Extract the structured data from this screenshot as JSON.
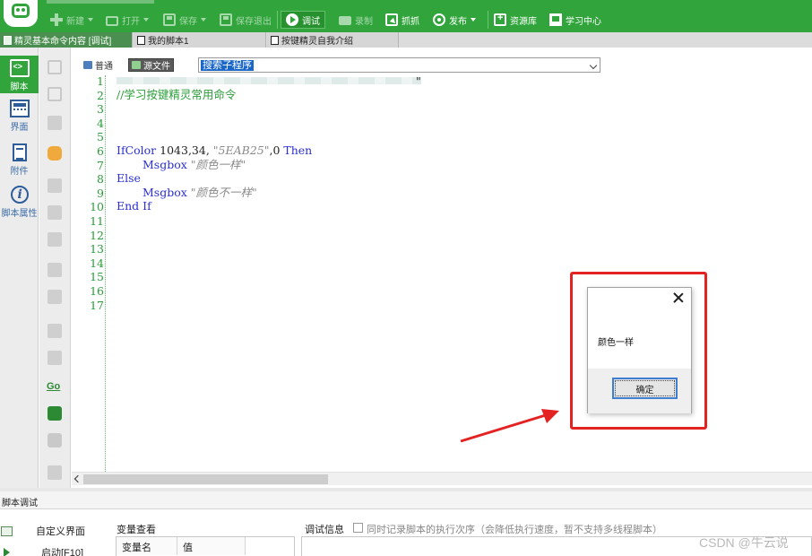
{
  "toolbar": {
    "buttons": [
      {
        "label": "新建",
        "state": "disabled"
      },
      {
        "label": "打开",
        "state": "disabled"
      },
      {
        "label": "保存",
        "state": "disabled"
      },
      {
        "label": "保存退出",
        "state": "disabled"
      },
      {
        "label": "调试",
        "state": "active"
      },
      {
        "label": "录制",
        "state": "disabled"
      },
      {
        "label": "抓抓",
        "state": "enabled"
      },
      {
        "label": "发布",
        "state": "enabled"
      },
      {
        "label": "资源库",
        "state": "enabled"
      },
      {
        "label": "学习中心",
        "state": "enabled"
      }
    ]
  },
  "tabs": [
    {
      "label": "精灵基本命令内容 [调试]",
      "active": true
    },
    {
      "label": "我的脚本1",
      "active": false
    },
    {
      "label": "按键精灵自我介绍",
      "active": false
    }
  ],
  "sidebar": {
    "items": [
      {
        "label": "脚本",
        "icon": "script-icon",
        "active": true
      },
      {
        "label": "界面",
        "icon": "ui-icon",
        "active": false
      },
      {
        "label": "附件",
        "icon": "attachment-icon",
        "active": false
      },
      {
        "label": "脚本属性",
        "icon": "info-icon",
        "active": false
      }
    ]
  },
  "editor": {
    "modes": [
      "普通",
      "源文件"
    ],
    "active_mode": "源文件",
    "subroutine_select": "搜索子程序",
    "line_numbers": [
      "1",
      "2",
      "3",
      "4",
      "5",
      "6",
      "7",
      "8",
      "9",
      "10",
      "11",
      "12",
      "13",
      "14",
      "15",
      "16",
      "17"
    ],
    "code": {
      "line1_tail": "\"",
      "line2": "//学习按键精灵常用命令",
      "line6_fn": "IfColor",
      "line6_args": " 1043,34, ",
      "line6_str": "\"5EAB25\"",
      "line6_rest": ",0 ",
      "line6_kw": "Then",
      "line7_fn": "Msgbox",
      "line7_str": "\"颜色一样\"",
      "line8_kw": "Else",
      "line9_fn": "Msgbox",
      "line9_str": "\"颜色不一样\"",
      "line10_kw1": "End",
      "line10_kw2": "If"
    }
  },
  "dialog": {
    "message": "颜色一样",
    "ok_label": "确定"
  },
  "bottom": {
    "panel_title": "脚本调试",
    "left_items": [
      "自定义界面",
      "启动[F10]"
    ],
    "var_label": "变量查看",
    "var_columns": [
      "变量名",
      "值"
    ],
    "debug_label": "调试信息",
    "record_checkbox_label": "同时记录脚本的执行次序（会降低执行速度，暂不支持多线程脚本）",
    "record_checked": false
  },
  "watermark": "CSDN @牛云说",
  "colors": {
    "brand_green": "#31a53c",
    "highlight_red": "#e32222",
    "selection_blue": "#1966c9"
  }
}
